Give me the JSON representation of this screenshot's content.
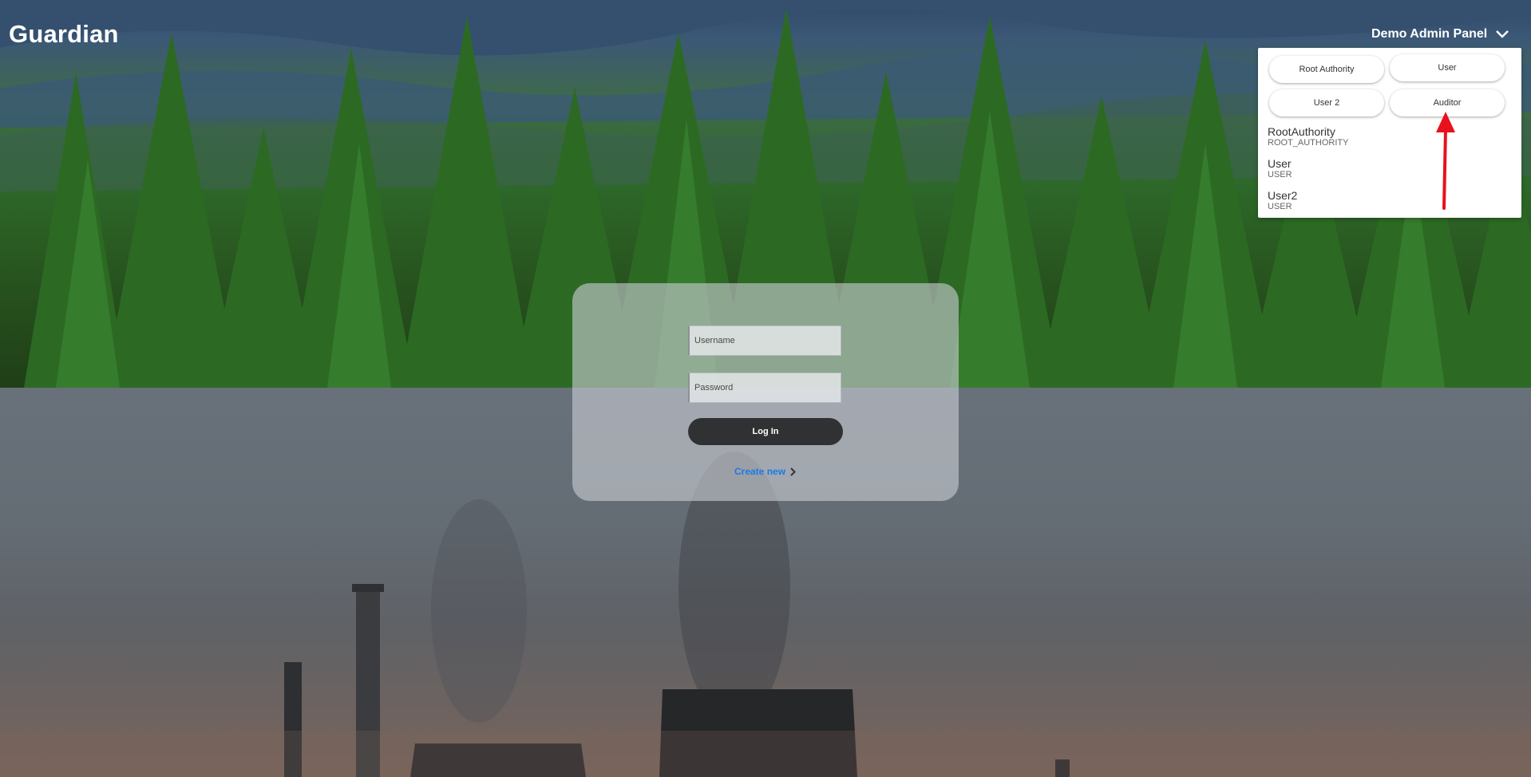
{
  "header": {
    "brand": "Guardian",
    "admin_panel_label": "Demo Admin Panel"
  },
  "admin_panel": {
    "buttons": [
      "Root Authority",
      "User",
      "User 2",
      "Auditor"
    ],
    "users": [
      {
        "name": "RootAuthority",
        "role": "ROOT_AUTHORITY"
      },
      {
        "name": "User",
        "role": "USER"
      },
      {
        "name": "User2",
        "role": "USER"
      }
    ]
  },
  "login": {
    "username_placeholder": "Username",
    "password_placeholder": "Password",
    "login_label": "Log In",
    "create_label": "Create new"
  },
  "icons": {
    "dropdown": "chevron-down-icon",
    "create": "chevron-right-icon"
  },
  "colors": {
    "accent_link": "#1a7ae8",
    "login_button": "#2f3133",
    "annotation_arrow": "#e8111c"
  }
}
